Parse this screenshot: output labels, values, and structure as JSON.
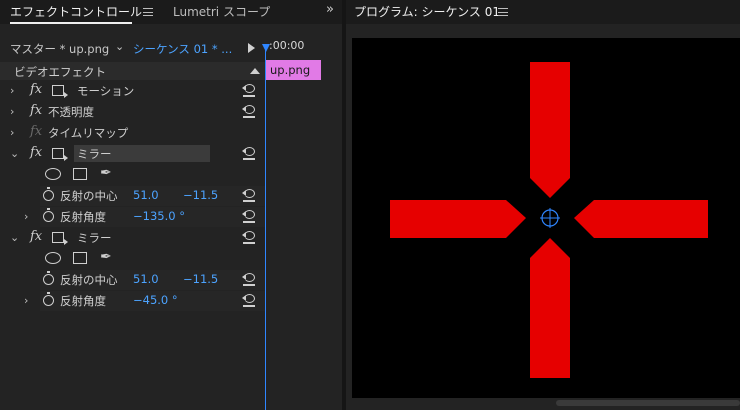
{
  "left_panel": {
    "tabs": [
      {
        "label": "エフェクトコントロール",
        "active": true
      },
      {
        "label": "Lumetri スコープ",
        "active": false
      }
    ],
    "overflow_label": "»",
    "clip_selector": {
      "master": "マスター * up.png",
      "sequence": "シーケンス 01 * ..."
    },
    "timeline": {
      "time": ":00:00",
      "clip_name": "up.png",
      "clip_color": "#e17ae6"
    },
    "section_label": "ビデオエフェクト",
    "effects": [
      {
        "name": "モーション"
      },
      {
        "name": "不透明度"
      },
      {
        "name": "タイムリマップ"
      },
      {
        "name": "ミラー"
      },
      {
        "name": "ミラー"
      }
    ],
    "mirror1": {
      "center_label": "反射の中心",
      "center_x": "51.0",
      "center_y": "−11.5",
      "angle_label": "反射角度",
      "angle_value": "−135.0 °"
    },
    "mirror2": {
      "center_label": "反射の中心",
      "center_x": "51.0",
      "center_y": "−11.5",
      "angle_label": "反射角度",
      "angle_value": "−45.0 °"
    }
  },
  "right_panel": {
    "title": "プログラム: シーケンス 01"
  },
  "colors": {
    "accent_blue": "#4ca3ff",
    "shape_red": "#e60000",
    "clip_pink": "#e17ae6"
  },
  "icons": [
    "menu-icon",
    "reset-icon",
    "stopwatch-icon",
    "ellipse-mask-icon",
    "rectangle-mask-icon",
    "pen-mask-icon",
    "fx-icon",
    "motion-transform-icon",
    "crosshair-icon"
  ]
}
